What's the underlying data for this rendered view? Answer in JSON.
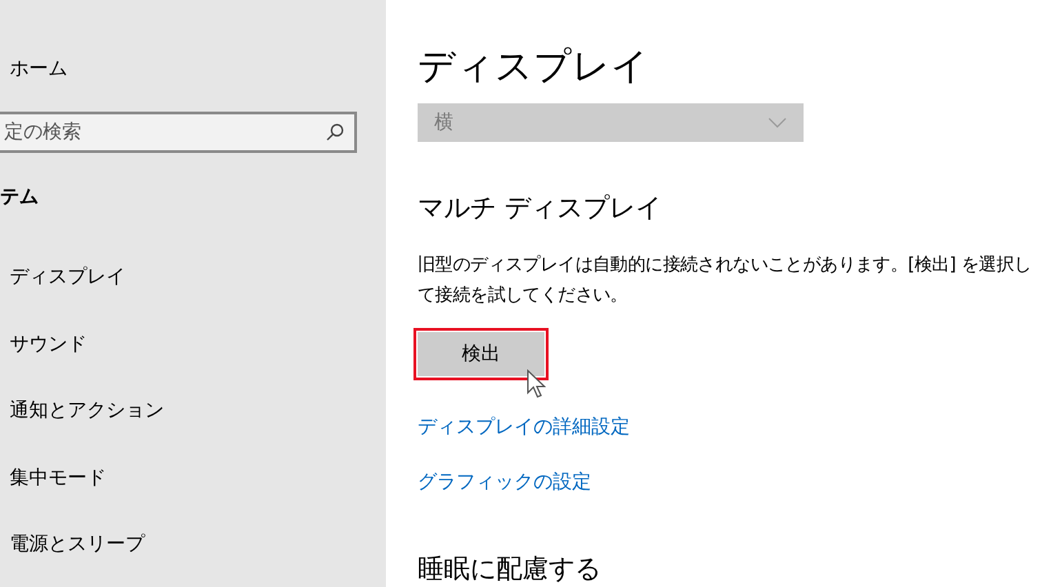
{
  "sidebar": {
    "home": "ホーム",
    "search": {
      "placeholder": "定の検索"
    },
    "section_title": "テム",
    "items": [
      {
        "label": "ディスプレイ"
      },
      {
        "label": "サウンド"
      },
      {
        "label": "通知とアクション"
      },
      {
        "label": "集中モード"
      },
      {
        "label": "電源とスリープ"
      }
    ]
  },
  "main": {
    "title": "ディスプレイ",
    "orientation": {
      "value": "横",
      "disabled": true
    },
    "multi_display": {
      "heading": "マルチ ディスプレイ",
      "description": "旧型のディスプレイは自動的に接続されないことがあります。[検出] を選択して接続を試してください。",
      "detect_button": {
        "label": "検出",
        "highlighted": true
      }
    },
    "links": [
      "ディスプレイの詳細設定",
      "グラフィックの設定"
    ],
    "night_heading": "睡眠に配慮する"
  }
}
